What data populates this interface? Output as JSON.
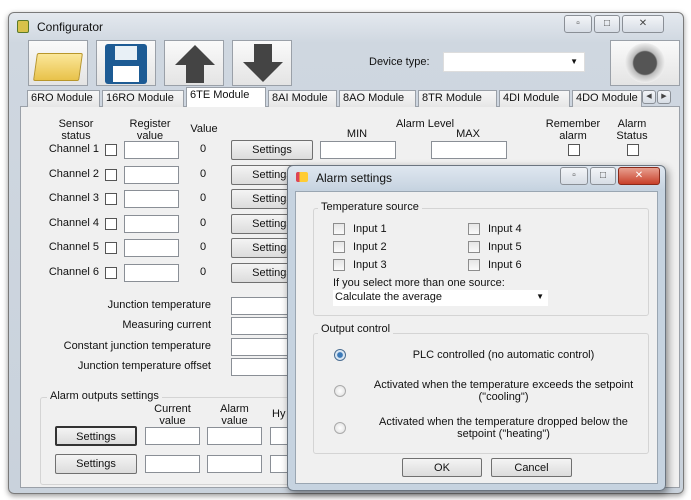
{
  "window": {
    "title": "Configurator",
    "icon": "app-icon"
  },
  "toolbar": {
    "open_icon": "folder-icon",
    "save_icon": "floppy-disk-icon",
    "upload_icon": "arrow-up-icon",
    "download_icon": "arrow-down-icon",
    "device_type_label": "Device type:",
    "device_type_value": "",
    "connect_icon": "round-button-icon"
  },
  "tabs": [
    "6RO Module",
    "16RO Module",
    "6TE Module",
    "8AI Module",
    "8AO Module",
    "8TR Module",
    "4DI Module",
    "4DO Module"
  ],
  "active_tab": "6TE Module",
  "table": {
    "sensor_status": "Sensor\nstatus",
    "register_value": "Register\nvalue",
    "value": "Value",
    "alarm_level": "Alarm Level",
    "min": "MIN",
    "max": "MAX",
    "remember_alarm": "Remember\nalarm",
    "alarm_status": "Alarm\nStatus",
    "channels": [
      {
        "label": "Channel 1",
        "value": "0"
      },
      {
        "label": "Channel 2",
        "value": "0"
      },
      {
        "label": "Channel 3",
        "value": "0"
      },
      {
        "label": "Channel 4",
        "value": "0"
      },
      {
        "label": "Channel 5",
        "value": "0"
      },
      {
        "label": "Channel 6",
        "value": "0"
      }
    ],
    "settings_label": "Settings"
  },
  "junction": [
    "Junction temperature",
    "Measuring current",
    "Constant junction temperature",
    "Junction temperature offset"
  ],
  "alarm_outputs": {
    "title": "Alarm outputs settings",
    "current_value": "Current\nvalue",
    "alarm_value": "Alarm\nvalue",
    "hy": "Hy",
    "settings_label": "Settings"
  },
  "dialog": {
    "title": "Alarm settings",
    "temp_source": "Temperature source",
    "inputs": [
      "Input 1",
      "Input 2",
      "Input 3",
      "Input 4",
      "Input 5",
      "Input 6"
    ],
    "multi_label": "If you select more than one source:",
    "multi_value": "Calculate the average",
    "output_control": "Output control",
    "options": [
      "PLC controlled (no automatic control)",
      "Activated when the temperature exceeds the setpoint (\"cooling\")",
      "Activated when the temperature dropped below the setpoint (\"heating\")"
    ],
    "selected_option": 0,
    "ok": "OK",
    "cancel": "Cancel"
  }
}
